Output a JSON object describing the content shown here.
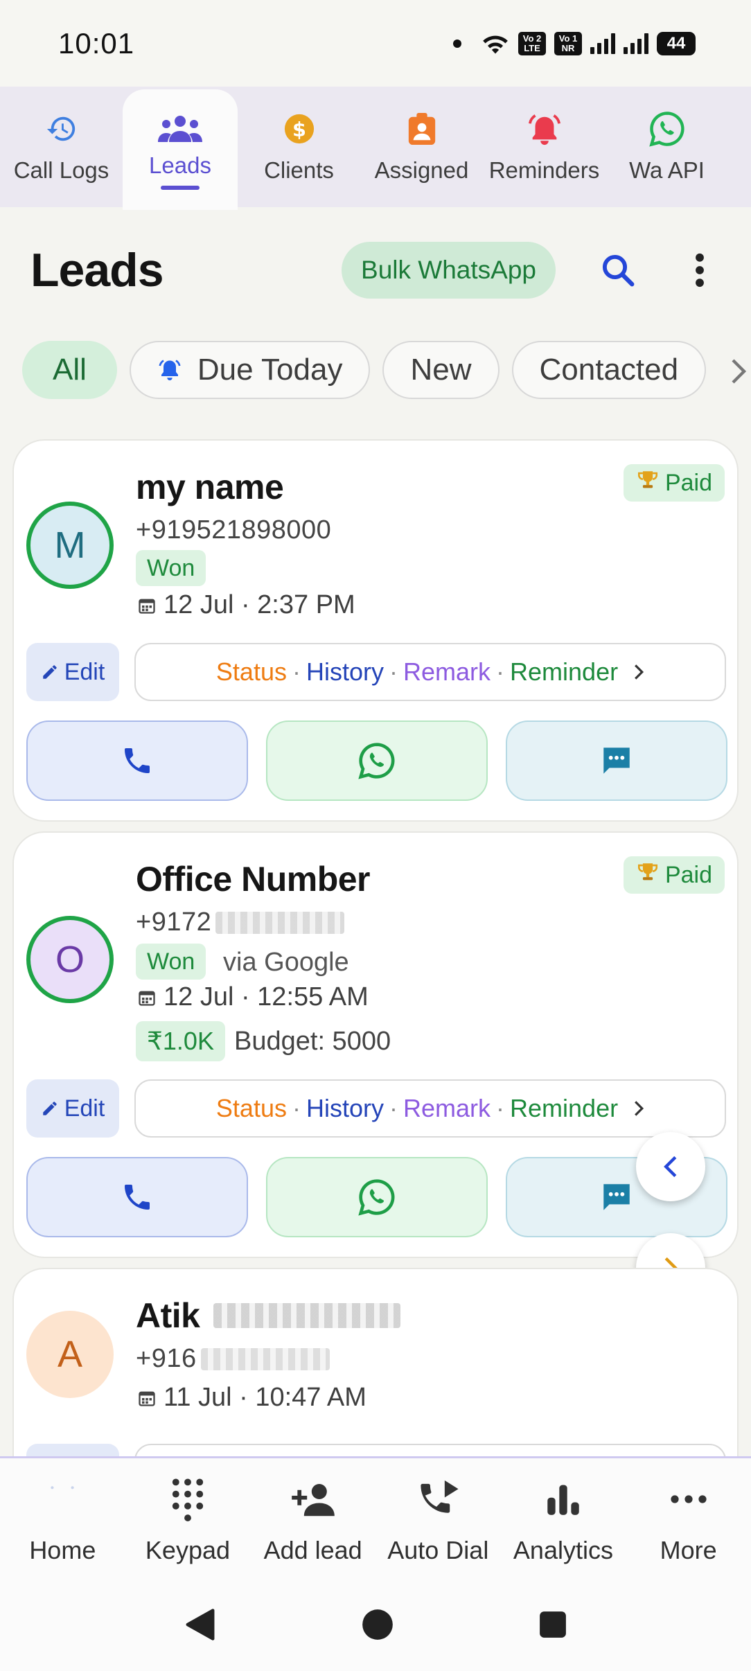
{
  "status_bar": {
    "time": "10:01",
    "sim1": "Vo 2 LTE",
    "sim2": "Vo 1 NR",
    "battery": "44"
  },
  "top_tabs": [
    {
      "label": "Call Logs",
      "icon": "history-clock-icon",
      "color": "#3f7fe0"
    },
    {
      "label": "Leads",
      "icon": "group-icon",
      "color": "#5b4fd1",
      "active": true
    },
    {
      "label": "Clients",
      "icon": "dollar-coin-icon",
      "color": "#e9a21f"
    },
    {
      "label": "Assigned",
      "icon": "badge-icon",
      "color": "#f07a2b"
    },
    {
      "label": "Reminders",
      "icon": "alarm-bell-icon",
      "color": "#ea3b4d"
    },
    {
      "label": "Wa API",
      "icon": "whatsapp-icon",
      "color": "#21b454"
    }
  ],
  "header": {
    "title": "Leads",
    "bulk_button": "Bulk WhatsApp"
  },
  "filter_chips": [
    {
      "label": "All",
      "active": true
    },
    {
      "label": "Due Today"
    },
    {
      "label": "New"
    },
    {
      "label": "Contacted"
    }
  ],
  "leads": [
    {
      "initial": "M",
      "name": "my name",
      "phone": "+919521898000",
      "status": "Won",
      "date": "12 Jul · 2:37 PM",
      "badge": "Paid",
      "avatar_bg": "#d8ecf3",
      "avatar_color": "#1f6d80"
    },
    {
      "initial": "O",
      "name": "Office Number",
      "phone": "+9172",
      "status": "Won",
      "source": "via Google",
      "date": "12 Jul · 12:55 AM",
      "badge": "Paid",
      "amount": "₹1.0K",
      "budget": "Budget: 5000",
      "avatar_bg": "#eadff9",
      "avatar_color": "#6a3aa6"
    },
    {
      "initial": "A",
      "name": "Atik",
      "phone": "+916",
      "date": "11 Jul · 10:47 AM",
      "avatar_bg": "#fde4cf",
      "avatar_color": "#c2601a"
    }
  ],
  "card_actions": {
    "edit": "Edit",
    "status": "Status",
    "history": "History",
    "remark": "Remark",
    "reminder": "Reminder",
    "separator": "·"
  },
  "bottom_nav": [
    {
      "label": "Home",
      "icon": "home-icon"
    },
    {
      "label": "Keypad",
      "icon": "dialpad-icon"
    },
    {
      "label": "Add lead",
      "icon": "add-person-icon"
    },
    {
      "label": "Auto Dial",
      "icon": "phone-forward-icon"
    },
    {
      "label": "Analytics",
      "icon": "bar-chart-icon"
    },
    {
      "label": "More",
      "icon": "more-horizontal-icon"
    }
  ]
}
